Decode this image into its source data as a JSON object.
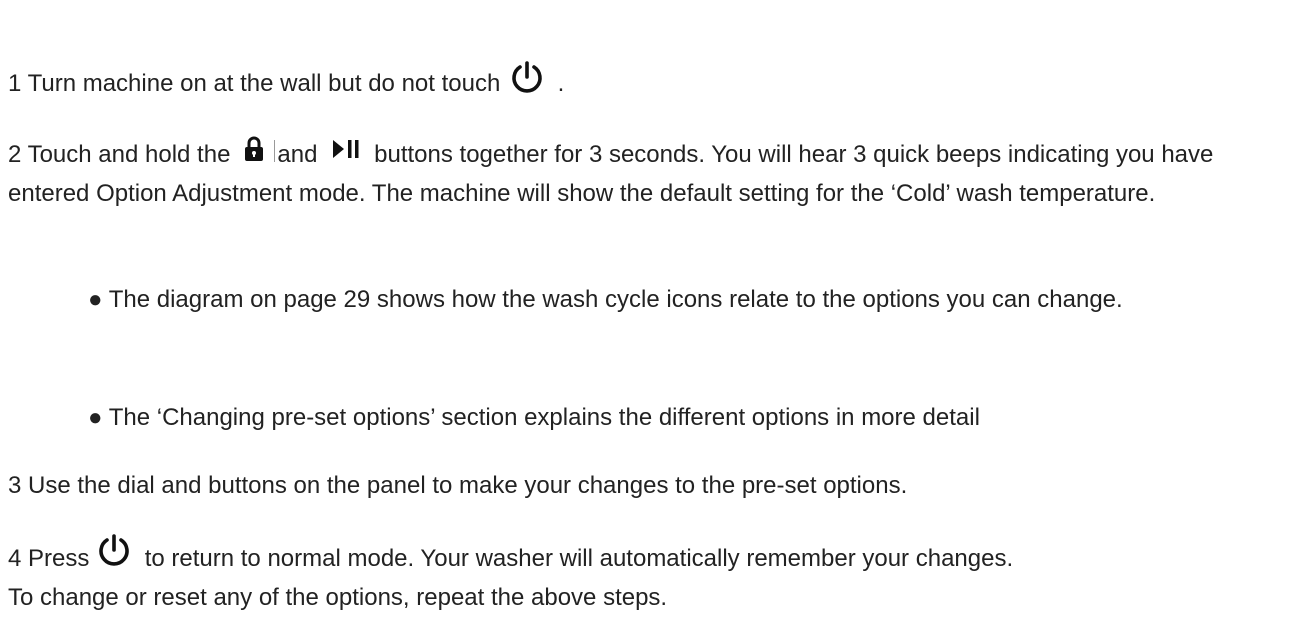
{
  "steps": {
    "step1": {
      "text": "1 Turn machine on at the wall but do not touch",
      "suffix": "."
    },
    "step2": {
      "before_lock": "2 Touch and hold the",
      "between": "and",
      "after_play": "buttons together for 3 seconds. You will hear 3 quick beeps indicating you have entered Option Adjustment mode. The machine will show the default setting for the ‘Cold’ wash temperature."
    },
    "bullets": [
      "● The diagram on page 29 shows how the wash cycle icons relate to the options you can change.",
      "● The ‘Changing pre-set options’ section explains the different options in more detail"
    ],
    "step3": {
      "text": "3 Use the dial and buttons on the panel to make your changes to the pre-set options."
    },
    "step4": {
      "before_icon": "4 Press",
      "after_icon": "to return to normal mode. Your washer will automatically remember your changes."
    }
  },
  "footer_note": "To change or reset any of the options, repeat the above steps.",
  "icons": {
    "power": "power-icon",
    "lock": "lock-icon",
    "play_pause": "play-pause-icon"
  },
  "colors": {
    "text": "#222222",
    "icon": "#111111",
    "background": "#ffffff"
  }
}
